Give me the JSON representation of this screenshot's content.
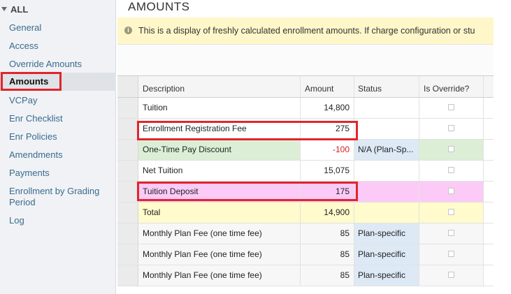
{
  "sidebar": {
    "root_label": "ALL",
    "items": [
      {
        "label": "General"
      },
      {
        "label": "Access"
      },
      {
        "label": "Override Amounts"
      },
      {
        "label": "Amounts"
      },
      {
        "label": "VCPay"
      },
      {
        "label": "Enr Checklist"
      },
      {
        "label": "Enr Policies"
      },
      {
        "label": "Amendments"
      },
      {
        "label": "Payments"
      },
      {
        "label": "Enrollment by Grading Period"
      },
      {
        "label": "Log"
      }
    ]
  },
  "page": {
    "title": "AMOUNTS",
    "info_text": "This is a display of freshly calculated enrollment amounts. If charge configuration or stu"
  },
  "table": {
    "columns": [
      "Description",
      "Amount",
      "Status",
      "Is Override?"
    ],
    "rows": [
      {
        "description": "Tuition",
        "amount": "14,800",
        "status": ""
      },
      {
        "description": "Enrollment Registration Fee",
        "amount": "275",
        "status": ""
      },
      {
        "description": "One-Time Pay Discount",
        "amount": "-100",
        "status": "N/A (Plan-Sp..."
      },
      {
        "description": "Net Tuition",
        "amount": "15,075",
        "status": ""
      },
      {
        "description": "Tuition Deposit",
        "amount": "175",
        "status": ""
      },
      {
        "description": "Total",
        "amount": "14,900",
        "status": ""
      },
      {
        "description": "Monthly Plan Fee (one time fee)",
        "amount": "85",
        "status": "Plan-specific"
      },
      {
        "description": "Monthly Plan Fee (one time fee)",
        "amount": "85",
        "status": "Plan-specific"
      },
      {
        "description": "Monthly Plan Fee (one time fee)",
        "amount": "85",
        "status": "Plan-specific"
      }
    ]
  },
  "colors": {
    "highlight_red": "#e0252d",
    "row_green": "#dcefd6",
    "row_pink": "#fccaf7",
    "row_yellow": "#fffbcc",
    "status_blue": "#dde9f5",
    "negative_red": "#d62020"
  }
}
